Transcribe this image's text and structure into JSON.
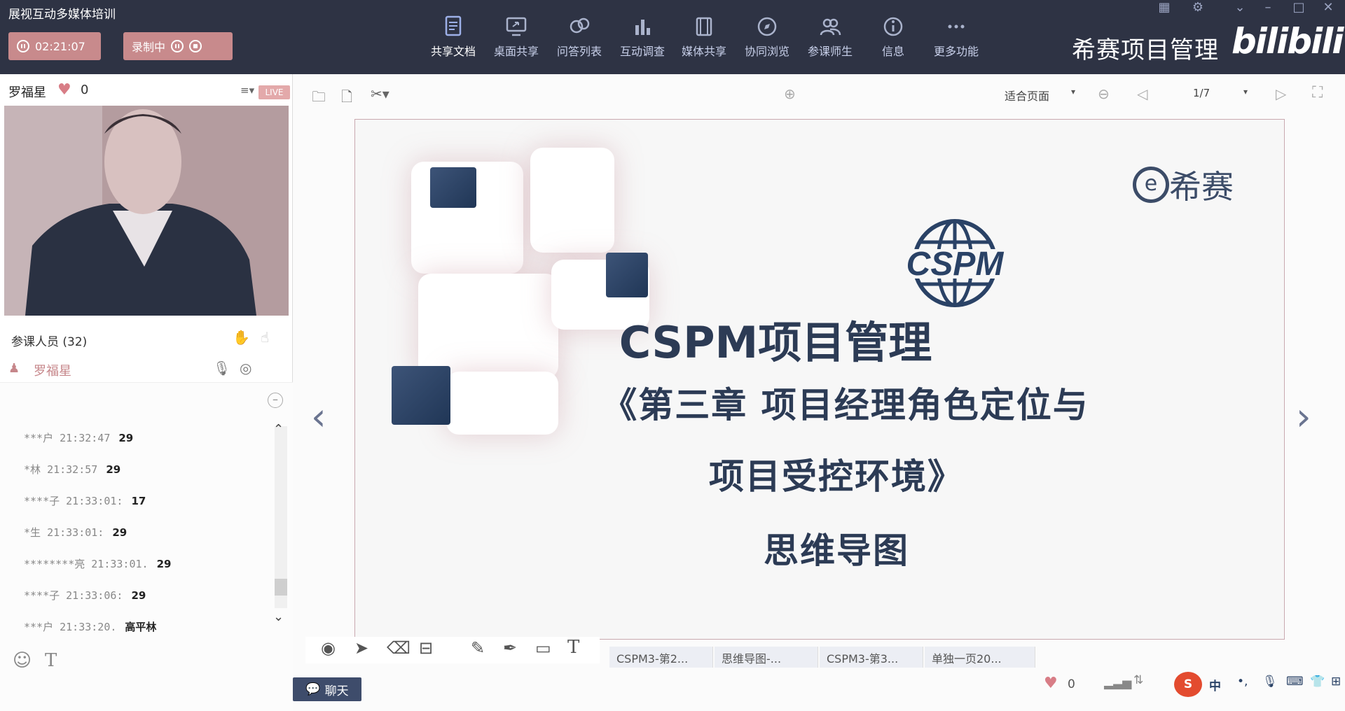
{
  "app": {
    "title": "展视互动多媒体培训",
    "brand": "希赛项目管理",
    "bili_logo": "bilibili"
  },
  "recording": {
    "timer": "02:21:07",
    "status_label": "录制中"
  },
  "toolbar": [
    {
      "label": "共享文档",
      "icon": "document-icon"
    },
    {
      "label": "桌面共享",
      "icon": "desktop-share-icon"
    },
    {
      "label": "问答列表",
      "icon": "qa-icon"
    },
    {
      "label": "互动调查",
      "icon": "bar-chart-icon"
    },
    {
      "label": "媒体共享",
      "icon": "film-icon"
    },
    {
      "label": "协同浏览",
      "icon": "compass-icon"
    },
    {
      "label": "参课师生",
      "icon": "users-icon"
    },
    {
      "label": "信息",
      "icon": "info-icon"
    },
    {
      "label": "更多功能",
      "icon": "more-icon"
    }
  ],
  "left": {
    "host_name": "罗福星",
    "likes": "0",
    "live_badge": "LIVE",
    "participants_label": "参课人员 (32)",
    "host_row_name": "罗福星"
  },
  "chat": [
    {
      "user": "***户",
      "time": "21:32:47",
      "text": "29"
    },
    {
      "user": "*林",
      "time": "21:32:57",
      "text": "29"
    },
    {
      "user": "****子",
      "time": "21:33:01:",
      "text": "17"
    },
    {
      "user": "*生",
      "time": "21:33:01:",
      "text": "29"
    },
    {
      "user": "********亮",
      "time": "21:33:01.",
      "text": "29"
    },
    {
      "user": "****子",
      "time": "21:33:06:",
      "text": "29"
    },
    {
      "user": "***户",
      "time": "21:33:20.",
      "text": "高平林"
    }
  ],
  "viewer": {
    "zoom": "适合页面",
    "page": "1/7"
  },
  "slide": {
    "logo_text": "希赛",
    "cspm_emblem": "CSPM",
    "title": "CSPM项目管理",
    "line1": "《第三章 项目经理角色定位与",
    "line2": "项目受控环境》",
    "line3": "思维导图"
  },
  "doc_tabs": [
    "CSPM3-第2...",
    "思维导图-...",
    "CSPM3-第3...",
    "单独一页20..."
  ],
  "bottom": {
    "chat_button": "聊天",
    "like_count": "0",
    "ime": "中"
  },
  "colors": {
    "topbar": "#2e3344",
    "pill": "#c88a8c",
    "slide_text": "#2c3b55",
    "accent_blue": "#2a4266"
  }
}
